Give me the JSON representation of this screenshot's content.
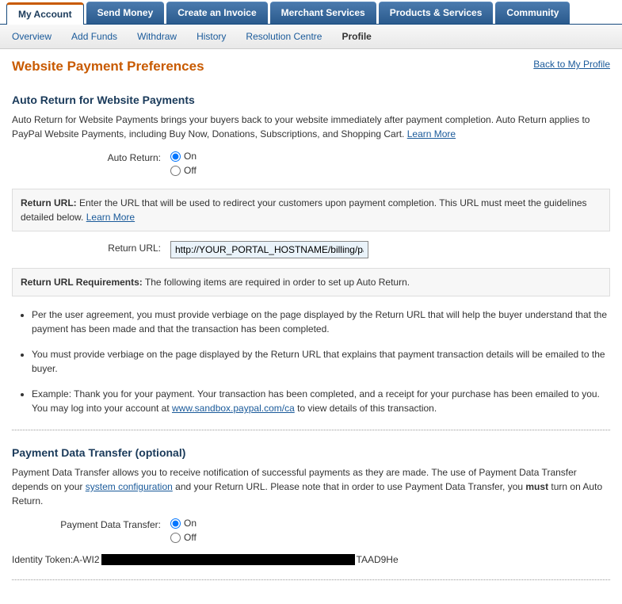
{
  "tabs": {
    "my_account": "My Account",
    "send_money": "Send Money",
    "create_invoice": "Create an Invoice",
    "merchant_services": "Merchant Services",
    "products_services": "Products & Services",
    "community": "Community"
  },
  "subnav": {
    "overview": "Overview",
    "add_funds": "Add Funds",
    "withdraw": "Withdraw",
    "history": "History",
    "resolution_centre": "Resolution Centre",
    "profile": "Profile"
  },
  "page": {
    "title": "Website Payment Preferences",
    "back_link": "Back to My Profile"
  },
  "auto_return": {
    "title": "Auto Return for Website Payments",
    "desc": "Auto Return for Website Payments brings your buyers back to your website immediately after payment completion. Auto Return applies to PayPal Website Payments, including Buy Now, Donations, Subscriptions, and Shopping Cart. ",
    "learn_more": "Learn More",
    "label": "Auto Return:",
    "on": "On",
    "off": "Off",
    "return_url_info_label": "Return URL:",
    "return_url_info_text": " Enter the URL that will be used to redirect your customers upon payment completion. This URL must meet the guidelines detailed below. ",
    "return_url_label": "Return URL:",
    "return_url_value": "http://YOUR_PORTAL_HOSTNAME/billing/pa",
    "requirements_label": "Return URL Requirements:",
    "requirements_text": " The following items are required in order to set up Auto Return.",
    "req1": "Per the user agreement, you must provide verbiage on the page displayed by the Return URL that will help the buyer understand that the payment has been made and that the transaction has been completed.",
    "req2": "You must provide verbiage on the page displayed by the Return URL that explains that payment transaction details will be emailed to the buyer.",
    "req3a": "Example: Thank you for your payment. Your transaction has been completed, and a receipt for your purchase has been emailed to you. You may log into your account at ",
    "req3_link": "www.sandbox.paypal.com/ca",
    "req3b": " to view details of this transaction."
  },
  "pdt": {
    "title": "Payment Data Transfer (optional)",
    "desc_a": "Payment Data Transfer allows you to receive notification of successful payments as they are made. The use of Payment Data Transfer depends on your ",
    "desc_link": "system configuration",
    "desc_b": " and your Return URL. Please note that in order to use Payment Data Transfer, you ",
    "desc_bold": "must",
    "desc_c": " turn on Auto Return.",
    "label": "Payment Data Transfer:",
    "on": "On",
    "off": "Off",
    "identity_label": "Identity Token:",
    "identity_prefix": "A-WI2",
    "identity_suffix": "TAAD9He"
  }
}
